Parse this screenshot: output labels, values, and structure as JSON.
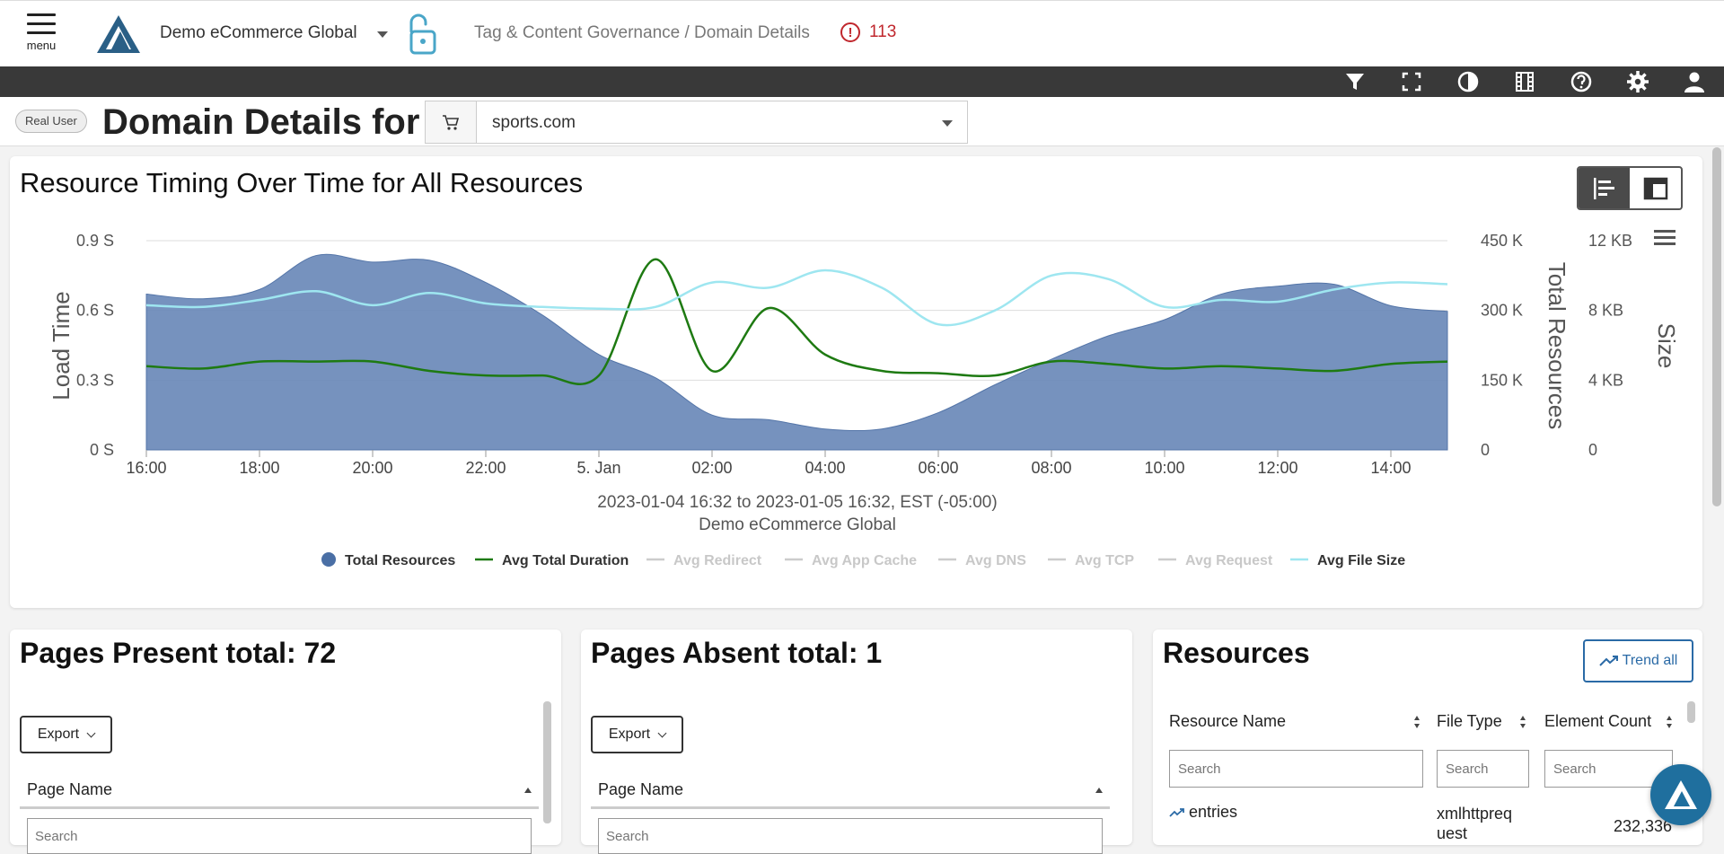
{
  "header": {
    "menu_label": "menu",
    "org_name": "Demo eCommerce Global",
    "breadcrumb": "Tag & Content Governance / Domain Details",
    "alert_count": "113",
    "alert_symbol": "!"
  },
  "toolbar": {
    "icons": [
      "filter-icon",
      "fullscreen-icon",
      "contrast-icon",
      "film-icon",
      "help-icon",
      "settings-icon",
      "user-icon"
    ]
  },
  "title_row": {
    "badge": "Real User",
    "title": "Domain Details for",
    "domain_value": "sports.com"
  },
  "chart_card": {
    "title": "Resource Timing Over Time for All Resources",
    "caption_line1": "2023-01-04 16:32 to 2023-01-05 16:32, EST (-05:00)",
    "caption_line2": "Demo eCommerce Global",
    "x_ticks": [
      "16:00",
      "18:00",
      "20:00",
      "22:00",
      "5. Jan",
      "02:00",
      "04:00",
      "06:00",
      "08:00",
      "10:00",
      "12:00",
      "14:00"
    ],
    "y_left_ticks": [
      "0.9 S",
      "0.6 S",
      "0.3 S",
      "0 S"
    ],
    "y_right1_ticks": [
      "450 K",
      "300 K",
      "150 K",
      "0"
    ],
    "y_right2_ticks": [
      "12 KB",
      "8 KB",
      "4 KB",
      "0"
    ],
    "y_left_label": "Load Time",
    "y_right1_label": "Total Resources",
    "y_right2_label": "Size",
    "legend": [
      {
        "name": "Total Resources",
        "active": true
      },
      {
        "name": "Avg Total Duration",
        "active": true
      },
      {
        "name": "Avg Redirect",
        "active": false
      },
      {
        "name": "Avg App Cache",
        "active": false
      },
      {
        "name": "Avg DNS",
        "active": false
      },
      {
        "name": "Avg TCP",
        "active": false
      },
      {
        "name": "Avg Request",
        "active": false
      },
      {
        "name": "Avg File Size",
        "active": true
      }
    ]
  },
  "chart_data": {
    "type": "area",
    "title": "Resource Timing Over Time for All Resources",
    "x_hours": [
      "16:00",
      "17:00",
      "18:00",
      "19:00",
      "20:00",
      "21:00",
      "22:00",
      "23:00",
      "00:00",
      "01:00",
      "02:00",
      "03:00",
      "04:00",
      "05:00",
      "06:00",
      "07:00",
      "08:00",
      "09:00",
      "10:00",
      "11:00",
      "12:00",
      "13:00",
      "14:00",
      "15:00"
    ],
    "series": [
      {
        "name": "Total Resources",
        "unit": "K",
        "axis": "right1",
        "color": "#6a89b9",
        "values": [
          335,
          325,
          345,
          418,
          404,
          408,
          360,
          290,
          205,
          155,
          75,
          65,
          45,
          45,
          80,
          140,
          195,
          245,
          280,
          335,
          352,
          356,
          310,
          298
        ]
      },
      {
        "name": "Avg Total Duration",
        "unit": "S",
        "axis": "left",
        "color": "#1e7a12",
        "values": [
          0.36,
          0.35,
          0.38,
          0.38,
          0.38,
          0.34,
          0.32,
          0.32,
          0.32,
          0.82,
          0.34,
          0.61,
          0.41,
          0.34,
          0.33,
          0.32,
          0.38,
          0.37,
          0.35,
          0.36,
          0.35,
          0.34,
          0.37,
          0.38
        ]
      },
      {
        "name": "Avg File Size",
        "unit": "KB",
        "axis": "right2",
        "color": "#9ee6f0",
        "values": [
          8.3,
          8.2,
          8.6,
          9.1,
          8.3,
          9.0,
          8.4,
          8.2,
          8.1,
          8.2,
          9.6,
          9.3,
          10.3,
          9.3,
          7.2,
          8.0,
          10.0,
          9.8,
          8.2,
          8.6,
          8.5,
          9.2,
          9.6,
          9.5
        ]
      }
    ],
    "ylim_left": [
      0,
      0.9
    ],
    "ylim_right1": [
      0,
      450
    ],
    "ylim_right2": [
      0,
      12
    ],
    "xlabel": "",
    "ylabel": "Load Time",
    "grid": true,
    "legend_position": "bottom"
  },
  "pages_present": {
    "title": "Pages Present total: 72",
    "export_label": "Export",
    "col_label": "Page Name",
    "search_placeholder": "Search"
  },
  "pages_absent": {
    "title": "Pages Absent total: 1",
    "export_label": "Export",
    "col_label": "Page Name",
    "search_placeholder": "Search"
  },
  "resources": {
    "title": "Resources",
    "trend_label": "Trend all",
    "columns": [
      "Resource Name",
      "File Type",
      "Element Count"
    ],
    "search_placeholder": "Search",
    "rows": [
      {
        "name": "entries",
        "type_line1": "xmlhttpreq",
        "type_line2": "uest",
        "count": "232,336"
      }
    ]
  },
  "colors": {
    "toolbar_bg": "#393939",
    "area_fill": "#6a89b9",
    "duration_line": "#1e7a12",
    "filesize_line": "#9ee6f0",
    "alert_red": "#c0272d",
    "accent_blue": "#2a6aa6"
  }
}
